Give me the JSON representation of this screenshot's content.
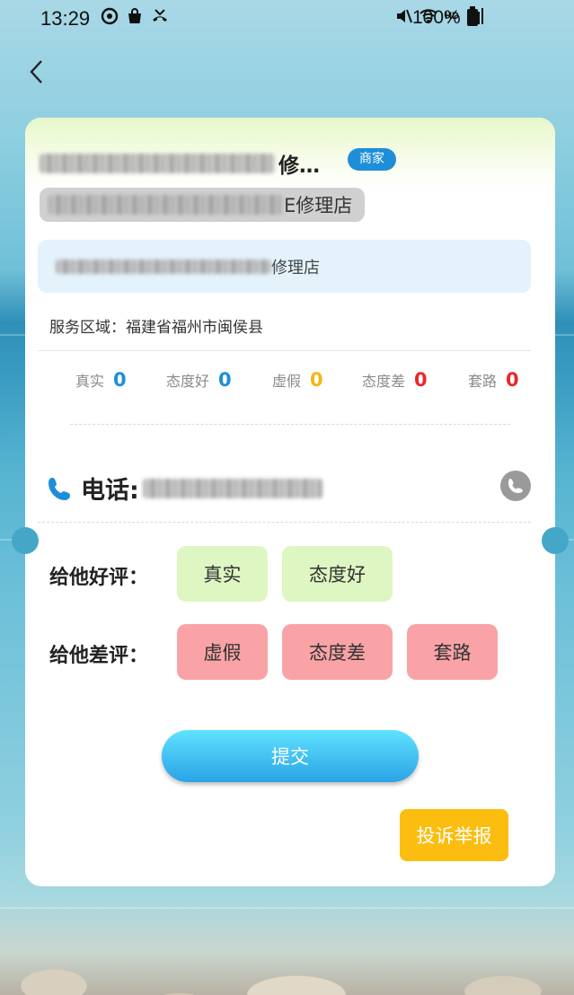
{
  "status_bar": {
    "time": "13:29",
    "battery": "100%",
    "icons_left": [
      "sync-icon",
      "bag-icon",
      "missed-call-icon"
    ],
    "icons_right": [
      "mute-icon",
      "wifi-icon",
      "hd-icon",
      "signal-icon",
      "battery-icon"
    ],
    "hd_label": "HD"
  },
  "header": {
    "back_icon": "chevron-left-icon"
  },
  "merchant": {
    "name_visible_part": "修…",
    "badge": "商家",
    "shop_tag_visible_part": "E修理店",
    "shop_name_visible_part": "修理店",
    "service_area": "服务区域：福建省福州市闽侯县"
  },
  "stats": [
    {
      "label": "真实",
      "value": "0",
      "color": "#1e8ed8"
    },
    {
      "label": "态度好",
      "value": "0",
      "color": "#1e8ed8"
    },
    {
      "label": "虚假",
      "value": "0",
      "color": "#f2b619"
    },
    {
      "label": "态度差",
      "value": "0",
      "color": "#e8282b"
    },
    {
      "label": "套路",
      "value": "0",
      "color": "#e8282b"
    }
  ],
  "phone": {
    "label": "电话:"
  },
  "good_review": {
    "label": "给他好评：",
    "tags": [
      "真实",
      "态度好"
    ]
  },
  "bad_review": {
    "label": "给他差评：",
    "tags": [
      "虚假",
      "态度差",
      "套路"
    ]
  },
  "actions": {
    "submit": "提交",
    "report": "投诉举报"
  },
  "colors": {
    "good_tag_bg": "#def6c2",
    "bad_tag_bg": "#f9a3a6",
    "submit_start": "#5fe2ff",
    "submit_end": "#2aa3e6",
    "report_bg": "#fbbd10"
  }
}
